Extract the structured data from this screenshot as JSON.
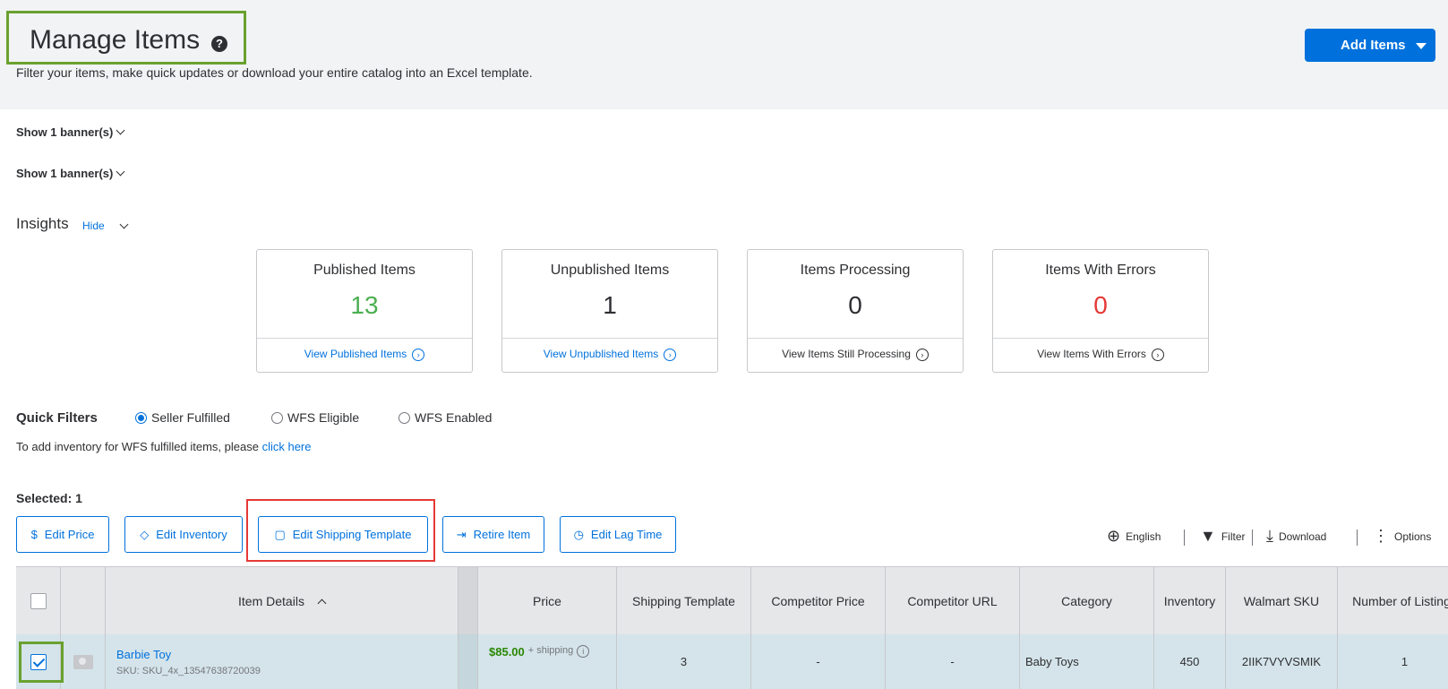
{
  "header": {
    "title": "Manage Items",
    "help_icon": "?",
    "subtitle": "Filter your items, make quick updates or download your entire catalog into an Excel template.",
    "add_items_label": "Add Items"
  },
  "banners": [
    "Show 1 banner(s)",
    "Show 1 banner(s)"
  ],
  "insights": {
    "title": "Insights",
    "hide_label": "Hide",
    "cards": [
      {
        "title": "Published Items",
        "value": "13",
        "value_color": "#4caf50",
        "link": "View Published Items",
        "link_color": "#0071dc"
      },
      {
        "title": "Unpublished Items",
        "value": "1",
        "value_color": "#2e2f32",
        "link": "View Unpublished Items",
        "link_color": "#0071dc"
      },
      {
        "title": "Items Processing",
        "value": "0",
        "value_color": "#2e2f32",
        "link": "View Items Still Processing",
        "link_color": "#2e2f32"
      },
      {
        "title": "Items With Errors",
        "value": "0",
        "value_color": "#e53935",
        "link": "View Items With Errors",
        "link_color": "#2e2f32"
      }
    ]
  },
  "quick_filters": {
    "label": "Quick Filters",
    "options": [
      "Seller Fulfilled",
      "WFS Eligible",
      "WFS Enabled"
    ],
    "selected": "Seller Fulfilled",
    "note_prefix": "To add inventory for WFS fulfilled items, please",
    "note_link": "click here"
  },
  "selection": {
    "label": "Selected: 1"
  },
  "actions": [
    {
      "label": "Edit Price",
      "icon": "dollar-circle-icon"
    },
    {
      "label": "Edit Inventory",
      "icon": "tag-icon"
    },
    {
      "label": "Edit Shipping Template",
      "icon": "package-icon"
    },
    {
      "label": "Retire Item",
      "icon": "retire-icon"
    },
    {
      "label": "Edit Lag Time",
      "icon": "clock-icon"
    }
  ],
  "tools": [
    {
      "label": "English",
      "icon": "globe-icon"
    },
    {
      "label": "Filter",
      "icon": "funnel-icon"
    },
    {
      "label": "Download",
      "icon": "download-icon"
    },
    {
      "label": "Options",
      "icon": "more-options-icon"
    }
  ],
  "table": {
    "headers": [
      "Item Details",
      "Price",
      "Shipping Template",
      "Competitor Price",
      "Competitor URL",
      "Category",
      "Inventory",
      "Walmart SKU",
      "Number of Listings"
    ],
    "rows": [
      {
        "name": "Barbie Toy",
        "sku": "SKU: SKU_4x_13547638720039",
        "price": "$85.00",
        "shipping": "+ shipping",
        "shipping_template": "3",
        "competitor_price": "-",
        "competitor_url": "-",
        "category": "Baby Toys",
        "inventory": "450",
        "walmart_sku": "2IIK7VYVSMIK",
        "listings": "1"
      }
    ]
  }
}
